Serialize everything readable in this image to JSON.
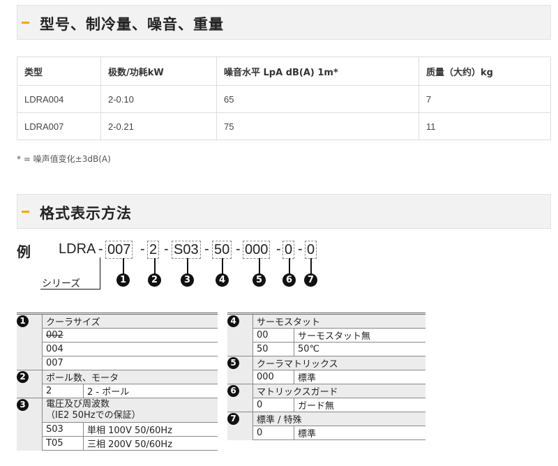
{
  "section1": {
    "title": "型号、制冷量、噪音、重量"
  },
  "spec_table": {
    "headers": [
      "类型",
      "极数/功耗kW",
      "噪音水平 LpA dB(A) 1m*",
      "质量（大约）kg"
    ],
    "rows": [
      [
        "LDRA004",
        "2-0.10",
        "65",
        "7"
      ],
      [
        "LDRA007",
        "2-0.21",
        "75",
        "11"
      ]
    ]
  },
  "note": "* = 噪声值变化±3dB(A)",
  "section2": {
    "title": "格式表示方法"
  },
  "example": {
    "label": "例",
    "prefix": "LDRA",
    "parts": [
      "007",
      "2",
      "S03",
      "50",
      "000",
      "0",
      "0"
    ],
    "dash": "-",
    "markers": [
      "1",
      "2",
      "3",
      "4",
      "5",
      "6",
      "7"
    ],
    "series_label": "シリーズ"
  },
  "left_table": {
    "groups": [
      {
        "marker": "1",
        "title": "クーラサイズ",
        "rows": [
          [
            "002",
            ""
          ],
          [
            "004",
            ""
          ],
          [
            "007",
            ""
          ]
        ]
      },
      {
        "marker": "2",
        "title": "ポール数、モータ",
        "rows": [
          [
            "2",
            "2 - ポール"
          ]
        ]
      },
      {
        "marker": "3",
        "title": "電圧及び周波数",
        "title2": "（IE2 50Hzでの保証）",
        "rows": [
          [
            "S03",
            "単相 100V 50/60Hz"
          ],
          [
            "T05",
            "三相 200V 50/60Hz"
          ]
        ]
      }
    ]
  },
  "right_table": {
    "groups": [
      {
        "marker": "4",
        "title": "サーモスタット",
        "rows": [
          [
            "00",
            "サーモスタット無"
          ],
          [
            "50",
            "50℃"
          ]
        ]
      },
      {
        "marker": "5",
        "title": "クーラマトリックス",
        "rows": [
          [
            "000",
            "標準"
          ]
        ]
      },
      {
        "marker": "6",
        "title": "マトリックスガード",
        "rows": [
          [
            "0",
            "ガード無"
          ]
        ]
      },
      {
        "marker": "7",
        "title": "標準 / 特殊",
        "rows": [
          [
            "0",
            "標準"
          ]
        ]
      }
    ]
  },
  "colors": {
    "accent": "#f5a800",
    "header_bg": "#f2f2f2"
  }
}
